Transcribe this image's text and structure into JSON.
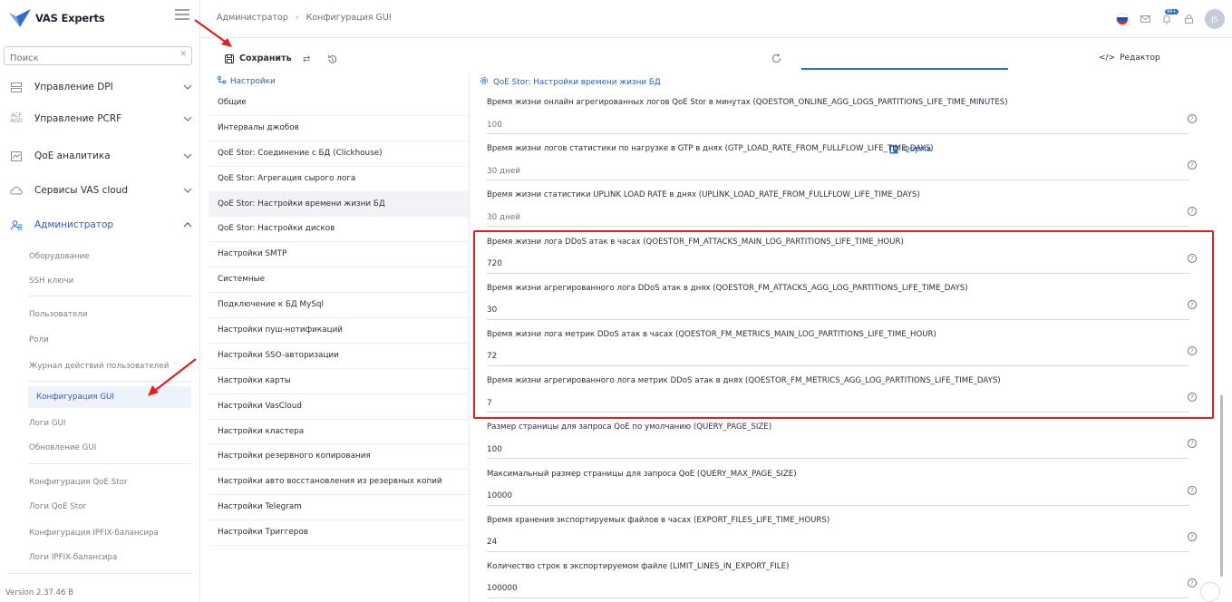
{
  "brand": {
    "name": "VAS Experts"
  },
  "search": {
    "placeholder": "Поиск"
  },
  "sidebar": {
    "groups": [
      {
        "label": "Управление DPI",
        "icon": "server-icon"
      },
      {
        "label": "Управление PCRF",
        "icon": "pcrf-icon"
      },
      {
        "label": "QoE аналитика",
        "icon": "chart-icon"
      },
      {
        "label": "Сервисы VAS cloud",
        "icon": "cloud-icon"
      },
      {
        "label": "Администратор",
        "icon": "users-icon"
      }
    ],
    "admin_items": [
      "Оборудование",
      "SSH ключи",
      "Пользователи",
      "Роли",
      "Журнал действий пользователей",
      "Конфигурация GUI",
      "Логи GUI",
      "Обновление GUI",
      "Конфигурация QoE Stor",
      "Логи QoE Stor",
      "Конфигурация IPFIX-балансира",
      "Логи IPFIX-балансира"
    ],
    "version": "Version 2.37.46 B"
  },
  "header": {
    "breadcrumbs": [
      "Администратор",
      "Конфигурация GUI"
    ],
    "avatar_initials": "JS",
    "badge": "99+"
  },
  "toolbar": {
    "save_label": "Сохранить",
    "tab_form": "Форма",
    "tab_editor": "Редактор",
    "editor_icon": "</>"
  },
  "settings": {
    "header": "Настройки",
    "items": [
      "Общие",
      "Интервалы джобов",
      "QoE Stor: Соединение с БД (Clickhouse)",
      "QoE Stor: Агрегация сырого лога",
      "QoE Stor: Настройки времени жизни БД",
      "QoE Stor: Настройки дисков",
      "Настройки SMTP",
      "Системные",
      "Подключение к БД MySql",
      "Настройки пуш-нотификаций",
      "Настройки SSO-авторизации",
      "Настройки карты",
      "Настройки VasCloud",
      "Настройки кластера",
      "Настройки резервного копирования",
      "Настройки авто восстановления из резервных копий",
      "Настройки Telegram",
      "Настройки Триггеров"
    ]
  },
  "form": {
    "header": "QoE Stor: Настройки времени жизни БД",
    "fields": [
      {
        "label": "Время жизни онлайн агрегированных логов QoE Stor в минутах (QOESTOR_ONLINE_AGG_LOGS_PARTITIONS_LIFE_TIME_MINUTES)",
        "value": "",
        "placeholder": "100"
      },
      {
        "label": "Время жизни логов статистики по нагрузке в GTP в днях (GTP_LOAD_RATE_FROM_FULLFLOW_LIFE_TIME_DAYS)",
        "value": "",
        "placeholder": "30 дней"
      },
      {
        "label": "Время жизни статистики UPLINK LOAD RATE в днях (UPLINK_LOAD_RATE_FROM_FULLFLOW_LIFE_TIME_DAYS)",
        "value": "",
        "placeholder": "30 дней"
      },
      {
        "label": "Время жизни лога DDoS атак в часах (QOESTOR_FM_ATTACKS_MAIN_LOG_PARTITIONS_LIFE_TIME_HOUR)",
        "value": "720",
        "placeholder": ""
      },
      {
        "label": "Время жизни агрегированного лога DDoS атак в днях (QOESTOR_FM_ATTACKS_AGG_LOG_PARTITIONS_LIFE_TIME_DAYS)",
        "value": "30",
        "placeholder": ""
      },
      {
        "label": "Время жизни лога метрик DDoS атак в часах (QOESTOR_FM_METRICS_MAIN_LOG_PARTITIONS_LIFE_TIME_HOUR)",
        "value": "72",
        "placeholder": ""
      },
      {
        "label": "Время жизни агрегированного лога метрик DDoS атак в днях (QOESTOR_FM_METRICS_AGG_LOG_PARTITIONS_LIFE_TIME_DAYS)",
        "value": "7",
        "placeholder": ""
      },
      {
        "label": "Размер страницы для запроса QoE по умолчанию (QUERY_PAGE_SIZE)",
        "value": "100",
        "placeholder": ""
      },
      {
        "label": "Максимальный размер страницы для запроса QoE (QUERY_MAX_PAGE_SIZE)",
        "value": "10000",
        "placeholder": ""
      },
      {
        "label": "Время хранения экспортируемых файлов в часах (EXPORT_FILES_LIFE_TIME_HOURS)",
        "value": "24",
        "placeholder": ""
      },
      {
        "label": "Количество строк в экспортируемом файле (LIMIT_LINES_IN_EXPORT_FILE)",
        "value": "100000",
        "placeholder": ""
      }
    ]
  },
  "colors": {
    "accent": "#2b6fd1",
    "highlight_box": "#e02020",
    "arrow": "#e02020"
  }
}
